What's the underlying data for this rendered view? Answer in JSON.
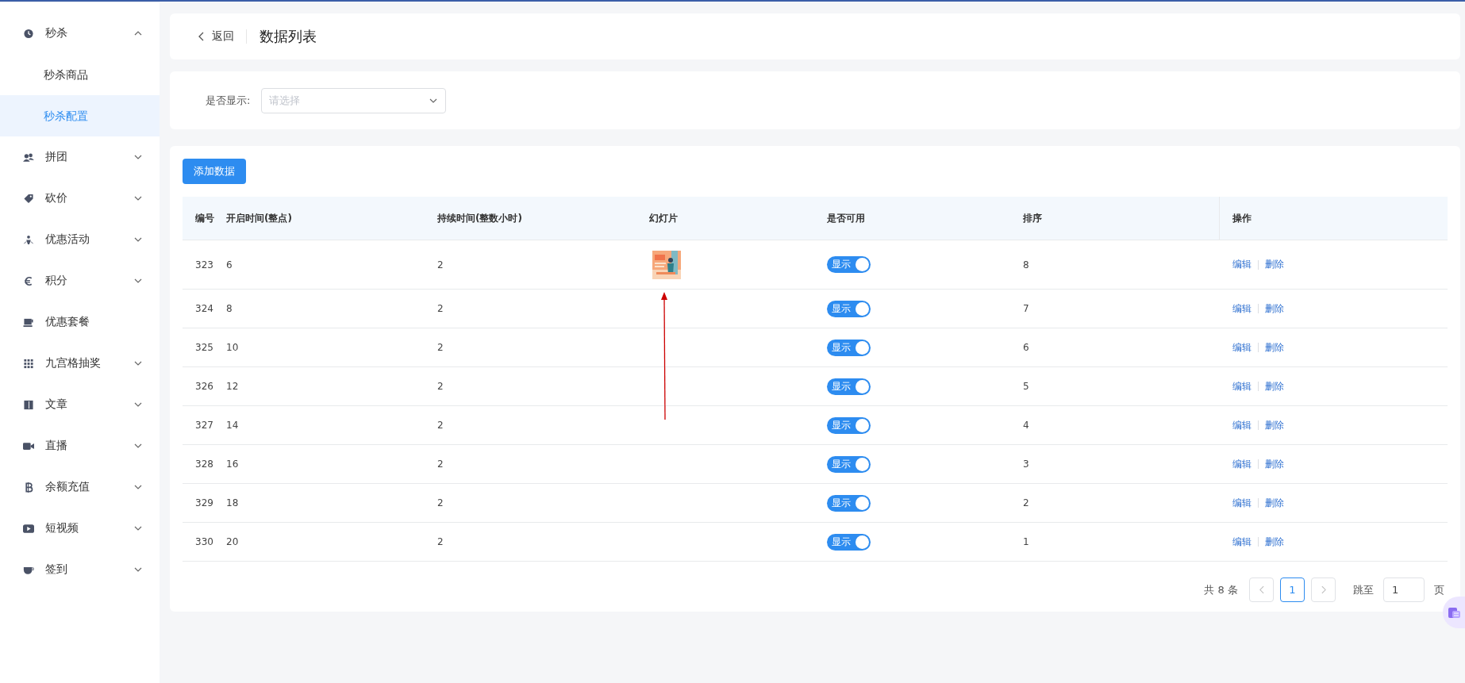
{
  "sidebar": {
    "items": [
      {
        "label": "秒杀",
        "expanded": true,
        "children": [
          {
            "label": "秒杀商品",
            "selected": false
          },
          {
            "label": "秒杀配置",
            "selected": true
          }
        ]
      },
      {
        "label": "拼团",
        "expanded": false
      },
      {
        "label": "砍价",
        "expanded": false
      },
      {
        "label": "优惠活动",
        "expanded": false
      },
      {
        "label": "积分",
        "expanded": false
      },
      {
        "label": "优惠套餐"
      },
      {
        "label": "九宫格抽奖",
        "expanded": false
      },
      {
        "label": "文章",
        "expanded": false
      },
      {
        "label": "直播",
        "expanded": false
      },
      {
        "label": "余额充值",
        "expanded": false
      },
      {
        "label": "短视频",
        "expanded": false
      },
      {
        "label": "签到",
        "expanded": false
      }
    ]
  },
  "header": {
    "back": "返回",
    "title": "数据列表"
  },
  "filter": {
    "label": "是否显示:",
    "placeholder": "请选择"
  },
  "toolbar": {
    "add_button": "添加数据"
  },
  "table": {
    "columns": [
      "编号",
      "开启时间(整点)",
      "持续时间(整数小时)",
      "幻灯片",
      "是否可用",
      "排序",
      "操作"
    ],
    "rows": [
      {
        "id": "323",
        "start": "6",
        "duration": "2",
        "enabled": {
          "on": true,
          "label": "显示"
        },
        "sort": "8",
        "actions": [
          "编辑",
          "删除"
        ]
      },
      {
        "id": "324",
        "start": "8",
        "duration": "2",
        "enabled": {
          "on": true,
          "label": "显示"
        },
        "sort": "7",
        "actions": [
          "编辑",
          "删除"
        ]
      },
      {
        "id": "325",
        "start": "10",
        "duration": "2",
        "enabled": {
          "on": true,
          "label": "显示"
        },
        "sort": "6",
        "actions": [
          "编辑",
          "删除"
        ]
      },
      {
        "id": "326",
        "start": "12",
        "duration": "2",
        "enabled": {
          "on": true,
          "label": "显示"
        },
        "sort": "5",
        "actions": [
          "编辑",
          "删除"
        ]
      },
      {
        "id": "327",
        "start": "14",
        "duration": "2",
        "enabled": {
          "on": true,
          "label": "显示"
        },
        "sort": "4",
        "actions": [
          "编辑",
          "删除"
        ]
      },
      {
        "id": "328",
        "start": "16",
        "duration": "2",
        "enabled": {
          "on": true,
          "label": "显示"
        },
        "sort": "3",
        "actions": [
          "编辑",
          "删除"
        ]
      },
      {
        "id": "329",
        "start": "18",
        "duration": "2",
        "enabled": {
          "on": true,
          "label": "显示"
        },
        "sort": "2",
        "actions": [
          "编辑",
          "删除"
        ]
      },
      {
        "id": "330",
        "start": "20",
        "duration": "2",
        "enabled": {
          "on": true,
          "label": "显示"
        },
        "sort": "1",
        "actions": [
          "编辑",
          "删除"
        ]
      }
    ]
  },
  "pagination": {
    "total": "共 8 条",
    "pages": [
      {
        "label": "1",
        "selected": true
      }
    ],
    "jump_label": "跳至",
    "jump_value": "1",
    "page_suffix": "页"
  }
}
